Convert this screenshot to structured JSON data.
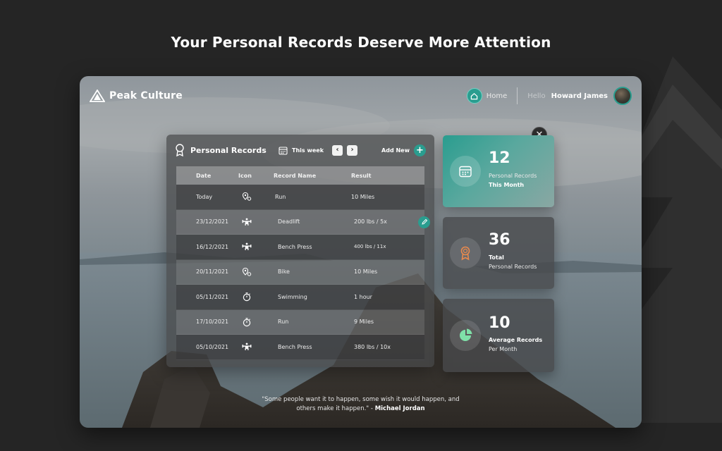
{
  "page": {
    "heading": "Your Personal Records Deserve More Attention"
  },
  "header": {
    "brand": "Peak Culture",
    "home_label": "Home",
    "greeting": "Hello",
    "user_name": "Howard James"
  },
  "records": {
    "title": "Personal Records",
    "period_label": "This week",
    "prev_label": "‹",
    "next_label": "›",
    "add_label": "Add New",
    "columns": {
      "date": "Date",
      "icon": "Icon",
      "name": "Record Name",
      "result": "Result"
    },
    "rows": [
      {
        "date": "Today",
        "icon": "location-pin-icon",
        "name": "Run",
        "result": "10 Miles"
      },
      {
        "date": "23/12/2021",
        "icon": "weightlifter-icon",
        "name": "Deadlift",
        "result": "200 lbs / 5x"
      },
      {
        "date": "16/12/2021",
        "icon": "weightlifter-icon",
        "name": "Bench Press",
        "result": "400 lbs / 11x"
      },
      {
        "date": "20/11/2021",
        "icon": "location-pin-icon",
        "name": "Bike",
        "result": "10 Miles"
      },
      {
        "date": "05/11/2021",
        "icon": "stopwatch-icon",
        "name": "Swimming",
        "result": "1 hour"
      },
      {
        "date": "17/10/2021",
        "icon": "stopwatch-icon",
        "name": "Run",
        "result": "9 Miles"
      },
      {
        "date": "05/10/2021",
        "icon": "weightlifter-icon",
        "name": "Bench Press",
        "result": "380 lbs / 10x"
      }
    ]
  },
  "stats": [
    {
      "value": "12",
      "line1": "Personal Records",
      "line2": "This Month",
      "icon": "calendar-icon"
    },
    {
      "value": "36",
      "line1": "Total",
      "line2": "Personal Records",
      "icon": "award-ribbon-icon"
    },
    {
      "value": "10",
      "line1": "Average Records",
      "line2": "Per Month",
      "icon": "pie-chart-icon"
    }
  ],
  "quote": {
    "line1": "\"Some people want it to happen, some wish it would happen, and",
    "line2": "others make it happen.\" - ",
    "author": "Michael Jordan"
  },
  "colors": {
    "accent": "#2a9d8f",
    "page_bg": "#252525"
  }
}
